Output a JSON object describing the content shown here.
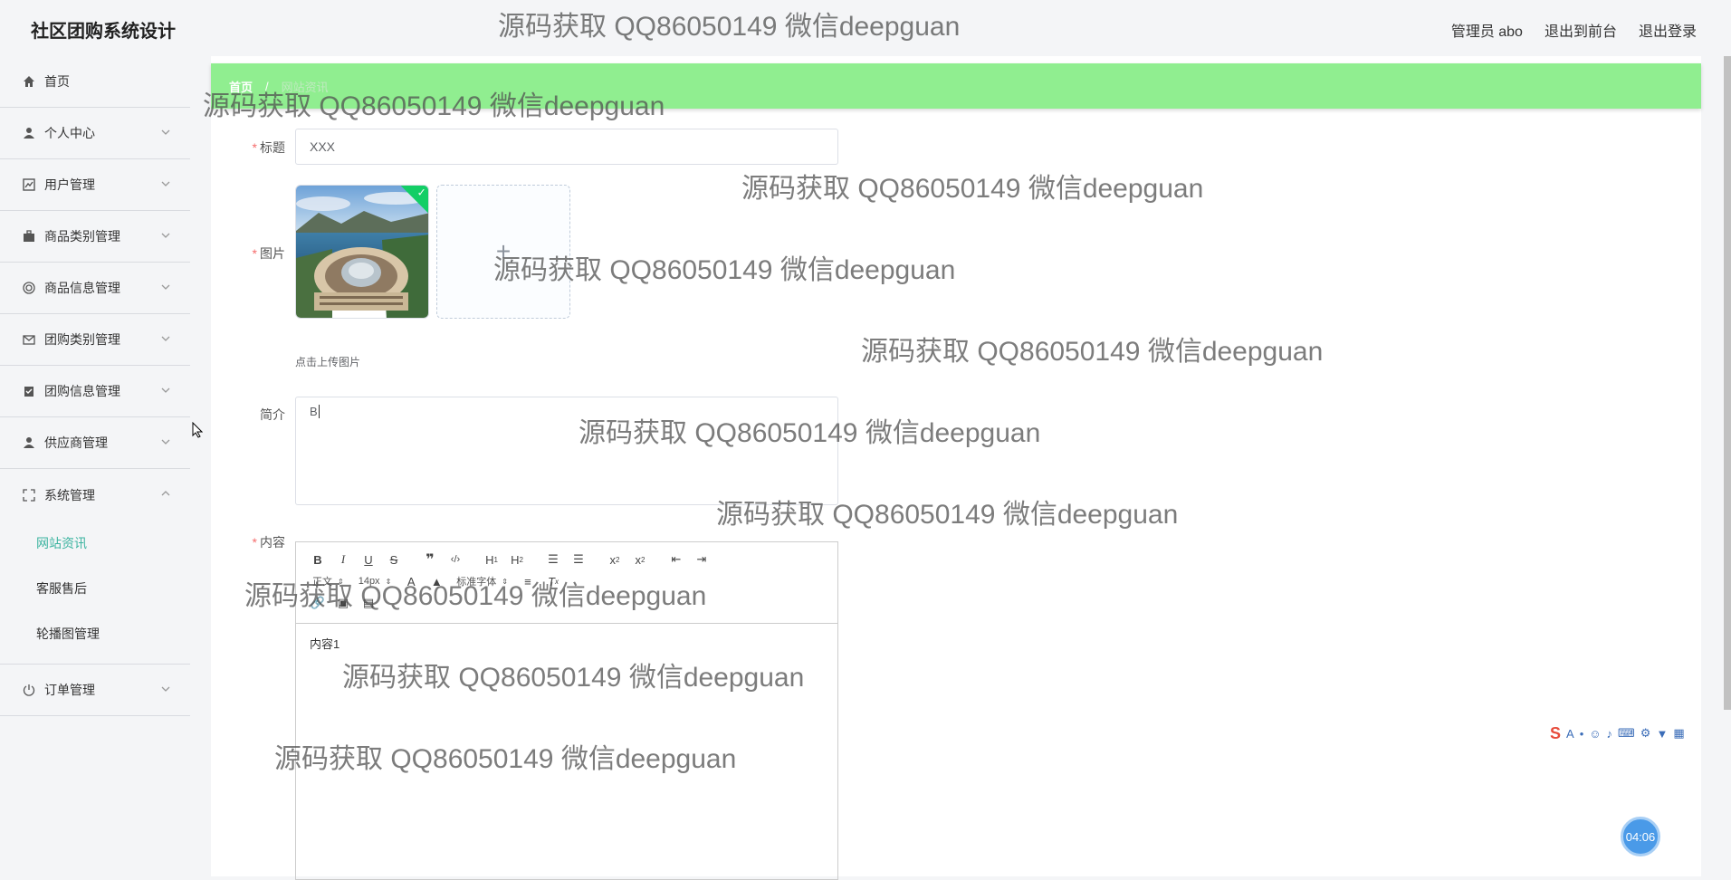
{
  "app": {
    "title": "社区团购系统设计"
  },
  "header": {
    "user_label": "管理员 abo",
    "frontend_link": "退出到前台",
    "logout_link": "退出登录"
  },
  "sidebar": {
    "items": [
      {
        "label": "首页",
        "icon": "home-icon"
      },
      {
        "label": "个人中心",
        "icon": "user-icon"
      },
      {
        "label": "用户管理",
        "icon": "chart-icon"
      },
      {
        "label": "商品类别管理",
        "icon": "briefcase-icon"
      },
      {
        "label": "商品信息管理",
        "icon": "target-icon"
      },
      {
        "label": "团购类别管理",
        "icon": "mail-icon"
      },
      {
        "label": "团购信息管理",
        "icon": "clipboard-icon"
      },
      {
        "label": "供应商管理",
        "icon": "user-icon"
      },
      {
        "label": "系统管理",
        "icon": "fullscreen-icon",
        "expanded": true,
        "children": [
          "网站资讯",
          "客服售后",
          "轮播图管理"
        ],
        "active_child": "网站资讯"
      },
      {
        "label": "订单管理",
        "icon": "power-icon"
      }
    ]
  },
  "breadcrumb": {
    "home": "首页",
    "separator": "/",
    "current": "网站资讯"
  },
  "form": {
    "title_label": "标题",
    "title_value": "XXX",
    "image_label": "图片",
    "upload_tip": "点击上传图片",
    "intro_label": "简介",
    "intro_value": "B",
    "content_label": "内容",
    "content_value": "内容1",
    "editor": {
      "heading_select": "正文",
      "size_select": "14px",
      "align_select": "标准字体"
    }
  },
  "watermark_text": "源码获取 QQ86050149 微信deepguan",
  "timer": "04:06",
  "colors": {
    "breadcrumb_bg": "#90ee90",
    "active": "#3cb4a0",
    "required": "#f56c6c"
  }
}
